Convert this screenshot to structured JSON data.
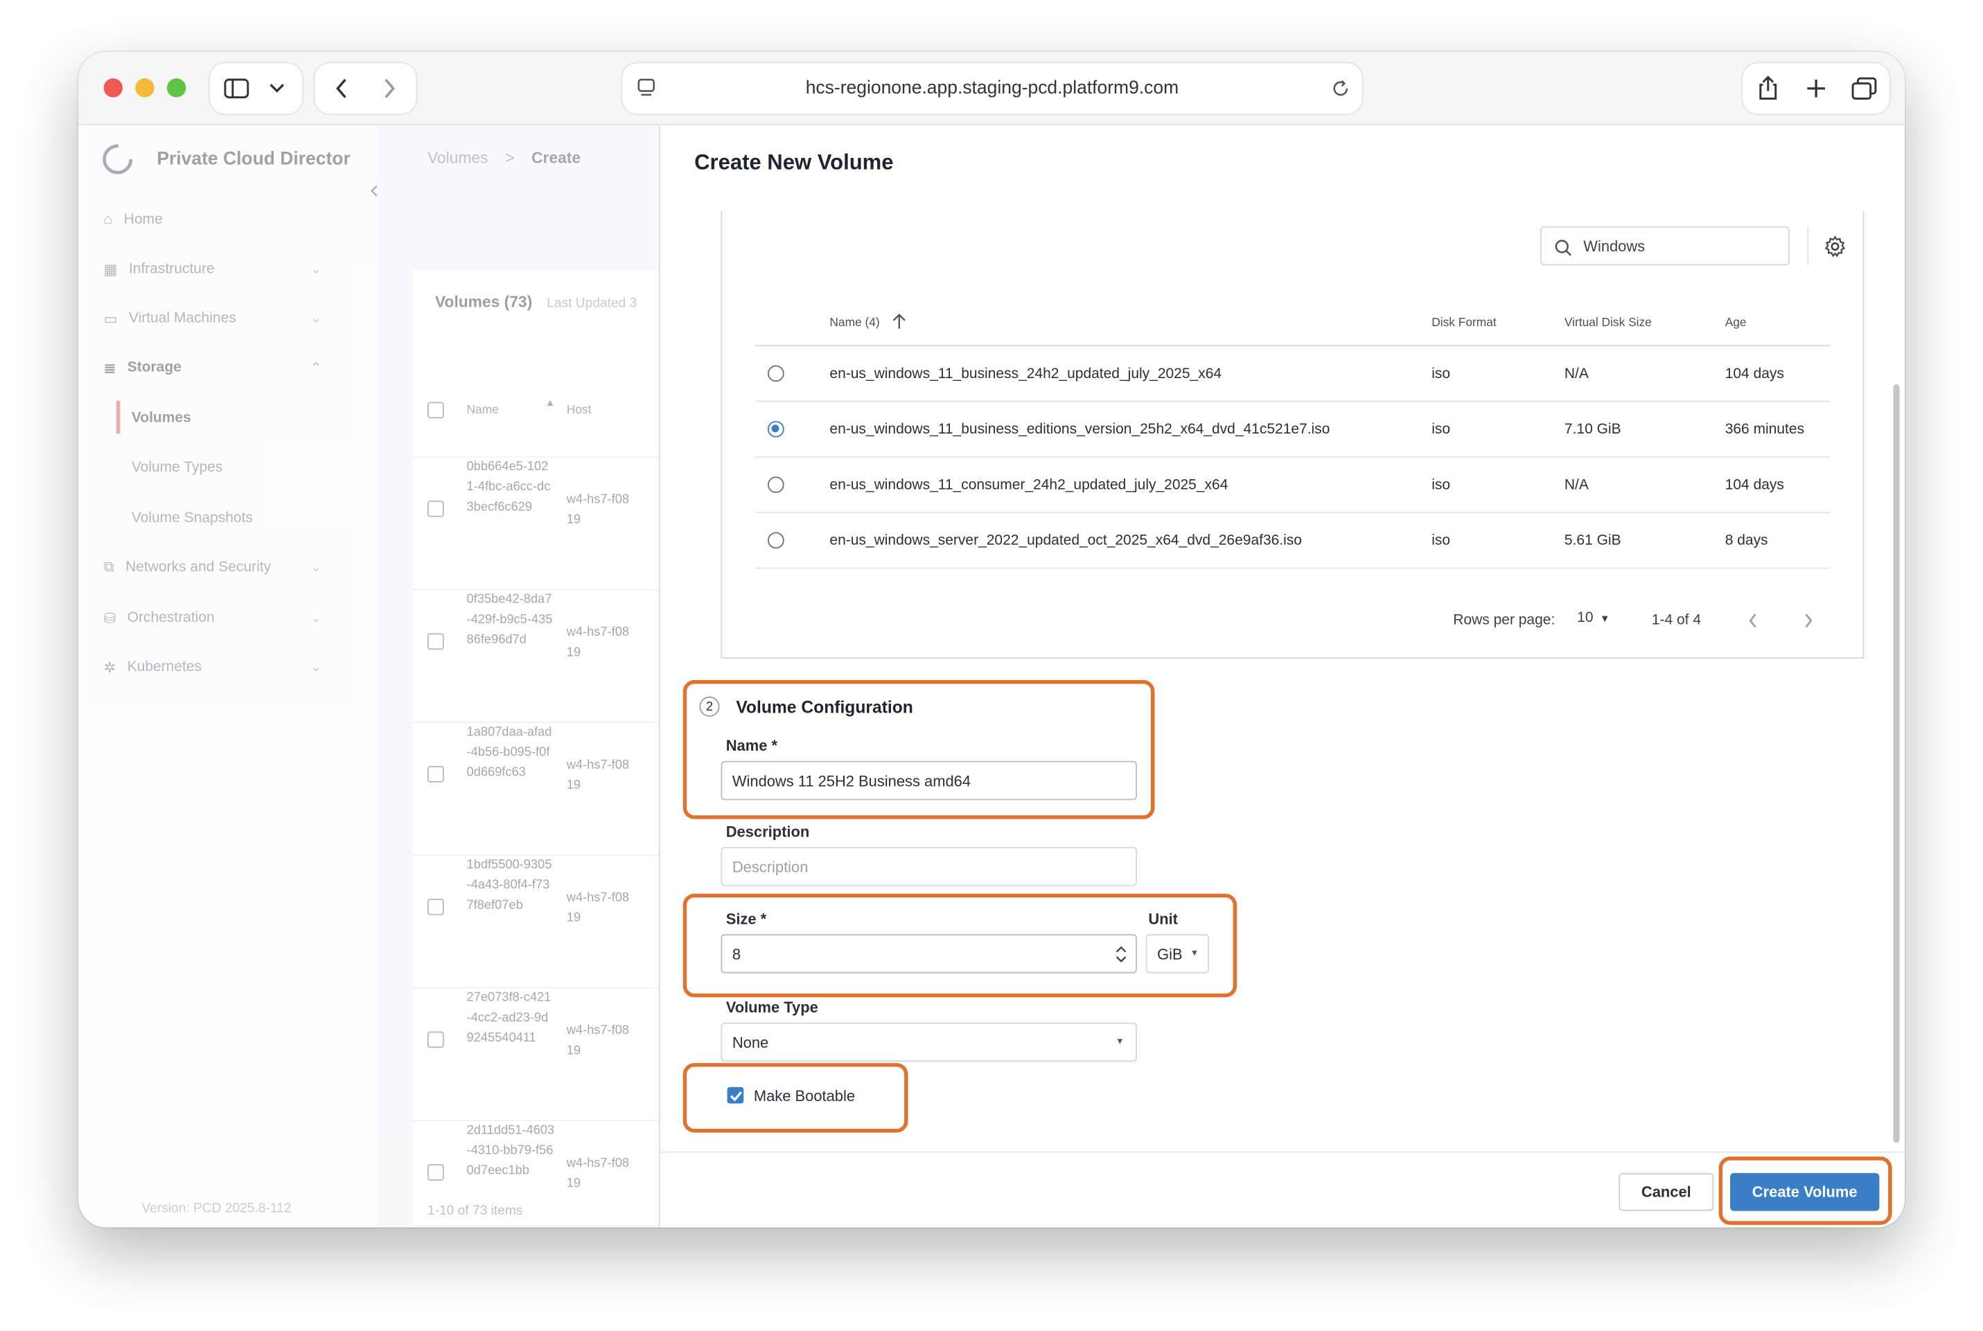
{
  "browser": {
    "url": "hcs-regionone.app.staging-pcd.platform9.com"
  },
  "sidebar": {
    "brand": "Private Cloud Director",
    "items": [
      {
        "label": "Home"
      },
      {
        "label": "Infrastructure"
      },
      {
        "label": "Virtual Machines"
      },
      {
        "label": "Storage"
      },
      {
        "label": "Volumes"
      },
      {
        "label": "Volume Types"
      },
      {
        "label": "Volume Snapshots"
      },
      {
        "label": "Networks and Security"
      },
      {
        "label": "Orchestration"
      },
      {
        "label": "Kubernetes"
      }
    ],
    "version": "Version: PCD 2025.8-112"
  },
  "background": {
    "breadcrumb_parent": "Volumes",
    "breadcrumb_sep": ">",
    "breadcrumb_current": "Create",
    "volumes_title": "Volumes (73)",
    "last_updated": "Last Updated 3",
    "col_name": "Name",
    "col_host": "Host",
    "rows": [
      {
        "name": "0bb664e5-1021-4fbc-a6cc-dc3becf6c629",
        "host": "w4-hs7-f0819"
      },
      {
        "name": "0f35be42-8da7-429f-b9c5-43586fe96d7d",
        "host": "w4-hs7-f0819"
      },
      {
        "name": "1a807daa-afad-4b56-b095-f0f0d669fc63",
        "host": "w4-hs7-f0819"
      },
      {
        "name": "1bdf5500-9305-4a43-80f4-f737f8ef07eb",
        "host": "w4-hs7-f0819"
      },
      {
        "name": "27e073f8-c421-4cc2-ad23-9d9245540411",
        "host": "w4-hs7-f0819"
      },
      {
        "name": "2d11dd51-4603-4310-bb79-f560d7eec1bb",
        "host": "w4-hs7-f0819"
      }
    ],
    "pager": "1-10 of 73 items"
  },
  "panel": {
    "title": "Create New Volume",
    "search": {
      "value": "Windows"
    },
    "table": {
      "headers": {
        "name": "Name (4)",
        "format": "Disk Format",
        "size": "Virtual Disk Size",
        "age": "Age"
      },
      "rows": [
        {
          "name": "en-us_windows_11_business_24h2_updated_july_2025_x64",
          "format": "iso",
          "size": "N/A",
          "age": "104 days",
          "selected": false
        },
        {
          "name": "en-us_windows_11_business_editions_version_25h2_x64_dvd_41c521e7.iso",
          "format": "iso",
          "size": "7.10 GiB",
          "age": "366 minutes",
          "selected": true
        },
        {
          "name": "en-us_windows_11_consumer_24h2_updated_july_2025_x64",
          "format": "iso",
          "size": "N/A",
          "age": "104 days",
          "selected": false
        },
        {
          "name": "en-us_windows_server_2022_updated_oct_2025_x64_dvd_26e9af36.iso",
          "format": "iso",
          "size": "5.61 GiB",
          "age": "8 days",
          "selected": false
        }
      ],
      "rows_per_page_label": "Rows per page:",
      "rows_per_page": "10",
      "range": "1-4 of 4"
    },
    "config": {
      "step": "2",
      "title": "Volume Configuration",
      "name_label": "Name *",
      "name_value": "Windows 11 25H2 Business amd64",
      "desc_label": "Description",
      "desc_placeholder": "Description",
      "size_label": "Size *",
      "size_value": "8",
      "unit_label": "Unit",
      "unit_value": "GiB",
      "type_label": "Volume Type",
      "type_value": "None",
      "bootable_label": "Make Bootable",
      "bootable_checked": true
    },
    "buttons": {
      "cancel": "Cancel",
      "create": "Create Volume"
    }
  },
  "colors": {
    "accent": "#3a7fc4",
    "highlight": "#e0722f"
  }
}
